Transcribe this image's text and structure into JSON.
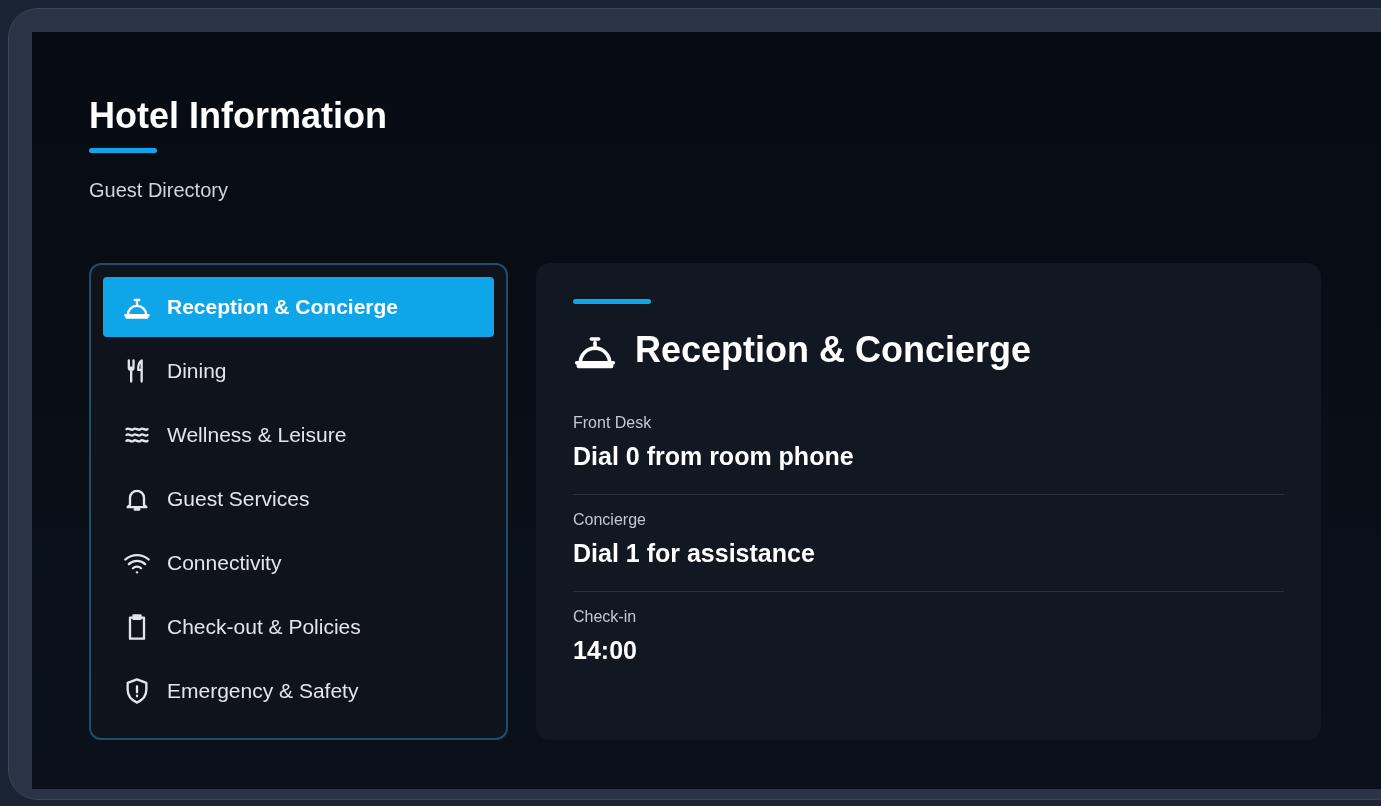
{
  "header": {
    "title": "Hotel Information",
    "subtitle": "Guest Directory"
  },
  "menu": [
    {
      "label": "Reception & Concierge",
      "selected": true
    },
    {
      "label": "Dining",
      "selected": false
    },
    {
      "label": "Wellness & Leisure",
      "selected": false
    },
    {
      "label": "Guest Services",
      "selected": false
    },
    {
      "label": "Connectivity",
      "selected": false
    },
    {
      "label": "Check-out & Policies",
      "selected": false
    },
    {
      "label": "Emergency & Safety",
      "selected": false
    }
  ],
  "detail": {
    "title": "Reception & Concierge",
    "rows": [
      {
        "label": "Front Desk",
        "value": "Dial 0 from room phone"
      },
      {
        "label": "Concierge",
        "value": "Dial 1 for assistance"
      },
      {
        "label": "Check-in",
        "value": "14:00"
      }
    ]
  }
}
